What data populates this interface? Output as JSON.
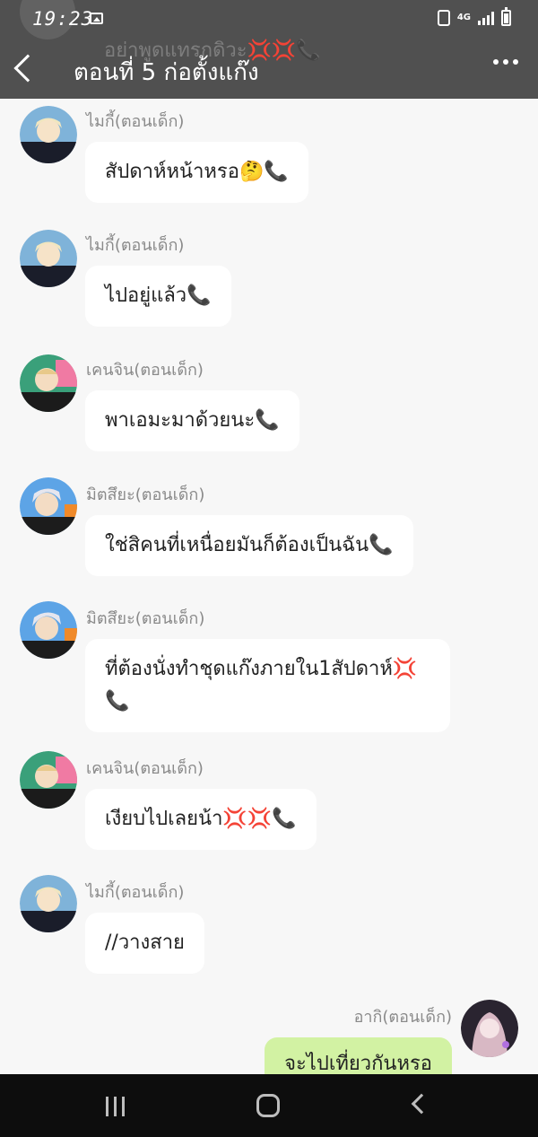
{
  "status_bar": {
    "time": "19:23",
    "network": "4G"
  },
  "header": {
    "title": "ตอนที่ 5 ก่อตั้งแก๊ง",
    "background_preview": "อย่าพูดแทรกดิวะ💢💢📞"
  },
  "messages": [
    {
      "sender": "ไมกี้(ตอนเด็ก)",
      "text": "สัปดาห์หน้าหรอ🤔📞",
      "avatar": "mikey-avatar"
    },
    {
      "sender": "ไมกี้(ตอนเด็ก)",
      "text": "ไปอยู่แล้ว📞",
      "avatar": "mikey-avatar"
    },
    {
      "sender": "เคนจิน(ตอนเด็ก)",
      "text": "พาเอมะมาด้วยนะ📞",
      "avatar": "kenchin-avatar"
    },
    {
      "sender": "มิตสึยะ(ตอนเด็ก)",
      "text": "ใช่สิคนที่เหนื่อยมันก็ต้องเป็นฉัน📞",
      "avatar": "mitsuya-avatar"
    },
    {
      "sender": "มิตสึยะ(ตอนเด็ก)",
      "text_line1": "ที่ต้องนั่งทำชุดแก๊งภายใน1สัปดาห์💢",
      "text_line2": "📞",
      "avatar": "mitsuya-avatar"
    },
    {
      "sender": "เคนจิน(ตอนเด็ก)",
      "text": "เงียบไปเลยน้า💢💢📞",
      "avatar": "kenchin-avatar"
    },
    {
      "sender": "ไมกี้(ตอนเด็ก)",
      "text": "//วางสาย",
      "avatar": "mikey-avatar"
    }
  ],
  "my_message": {
    "sender": "อากิ(ตอนเด็ก)",
    "text": "จะไปเที่ยวกันหรอ",
    "avatar": "aki-avatar"
  },
  "colors": {
    "header_bg": "#505050",
    "page_bg": "#f7f7f7",
    "bubble_in": "#ffffff",
    "bubble_out": "#d2f2a3",
    "nav_bg": "#0d0d0d"
  },
  "nav": {
    "recents_icon": "recents-icon",
    "home_icon": "home-icon",
    "back_icon": "nav-back-icon"
  }
}
